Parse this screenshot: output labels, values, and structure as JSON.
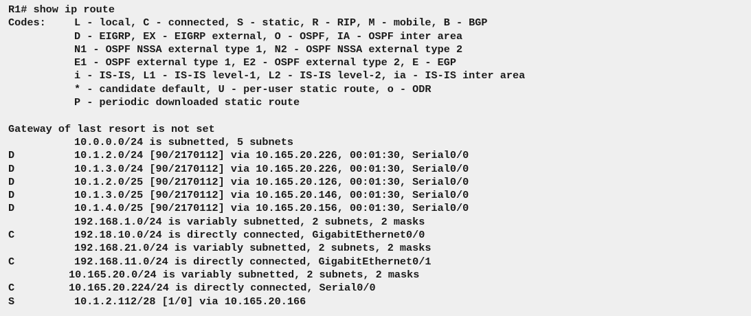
{
  "terminal": {
    "prompt_line": "R1# show ip route",
    "codes": [
      {
        "code": "Codes:",
        "text": "L - local, C - connected, S - static, R - RIP, M - mobile, B - BGP"
      },
      {
        "code": "",
        "text": "D - EIGRP, EX - EIGRP external, O - OSPF, IA - OSPF inter area"
      },
      {
        "code": "",
        "text": "N1 - OSPF NSSA external type 1, N2 - OSPF NSSA external type 2"
      },
      {
        "code": "",
        "text": "E1 - OSPF external type 1, E2 - OSPF external type 2, E - EGP"
      },
      {
        "code": "",
        "text": "i - IS-IS, L1 - IS-IS level-1, L2 - IS-IS level-2, ia - IS-IS inter area"
      },
      {
        "code": "",
        "text": "* - candidate default, U - per-user static route, o - ODR"
      },
      {
        "code": "",
        "text": "P - periodic downloaded static route"
      }
    ],
    "gateway_line": "Gateway of last resort is not set",
    "routes": [
      {
        "code": "",
        "text": "10.0.0.0/24 is subnetted, 5 subnets"
      },
      {
        "code": "D",
        "text": "10.1.2.0/24 [90/2170112] via 10.165.20.226, 00:01:30, Serial0/0"
      },
      {
        "code": "D",
        "text": "10.1.3.0/24 [90/2170112] via 10.165.20.226, 00:01:30, Serial0/0"
      },
      {
        "code": "D",
        "text": "10.1.2.0/25 [90/2170112] via 10.165.20.126, 00:01:30, Serial0/0"
      },
      {
        "code": "D",
        "text": "10.1.3.0/25 [90/2170112] via 10.165.20.146, 00:01:30, Serial0/0"
      },
      {
        "code": "D",
        "text": "10.1.4.0/25 [90/2170112] via 10.165.20.156, 00:01:30, Serial0/0"
      },
      {
        "code": "",
        "text": "192.168.1.0/24 is variably subnetted, 2 subnets, 2 masks"
      },
      {
        "code": "C",
        "text": "192.18.10.0/24 is directly connected, GigabitEthernet0/0"
      },
      {
        "code": "",
        "text": "192.168.21.0/24 is variably subnetted, 2 subnets, 2 masks"
      },
      {
        "code": "C",
        "text": "192.168.11.0/24 is directly connected, GigabitEthernet0/1"
      },
      {
        "code": "",
        "text": "10.165.20.0/24 is variably subnetted, 2 subnets, 2 masks"
      },
      {
        "code": "C",
        "text": "10.165.20.224/24 is directly connected, Serial0/0"
      },
      {
        "code": "S",
        "text": "10.1.2.112/28 [1/0] via 10.165.20.166"
      }
    ]
  }
}
